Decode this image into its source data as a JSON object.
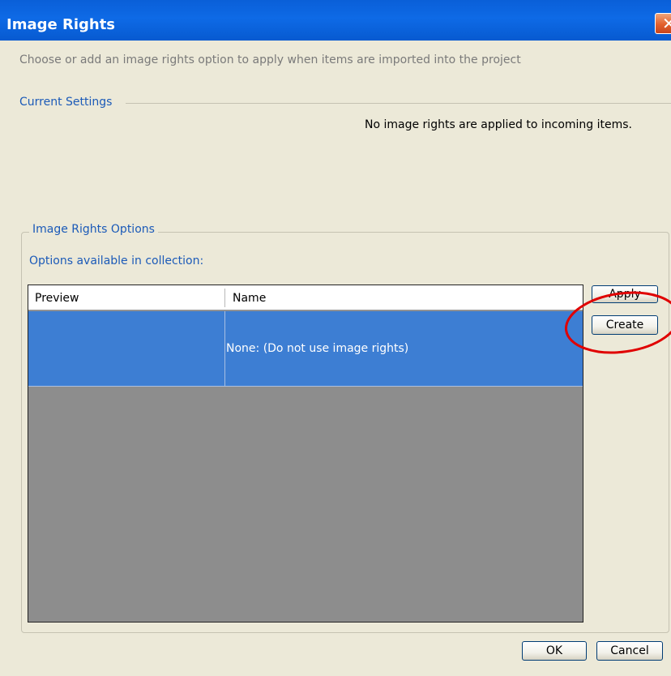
{
  "window": {
    "title": "Image Rights",
    "close_glyph": "✕"
  },
  "instruction": "Choose or add an image rights option to apply when items are imported into the project",
  "current_settings": {
    "label": "Current Settings",
    "value": "No image rights are applied to incoming items."
  },
  "options": {
    "label": "Image Rights Options",
    "available_label": "Options available in collection:",
    "columns": [
      "Preview",
      "Name"
    ],
    "rows": [
      {
        "preview": "",
        "name": "None: (Do not use image rights)",
        "selected": true
      }
    ]
  },
  "buttons": {
    "apply": "Apply",
    "create": "Create",
    "ok": "OK",
    "cancel": "Cancel"
  },
  "colors": {
    "titlebar": "#0e6ae6",
    "selection": "#3d7ed3",
    "group_label": "#1b5ab8",
    "annotation_circle": "#e00000"
  }
}
